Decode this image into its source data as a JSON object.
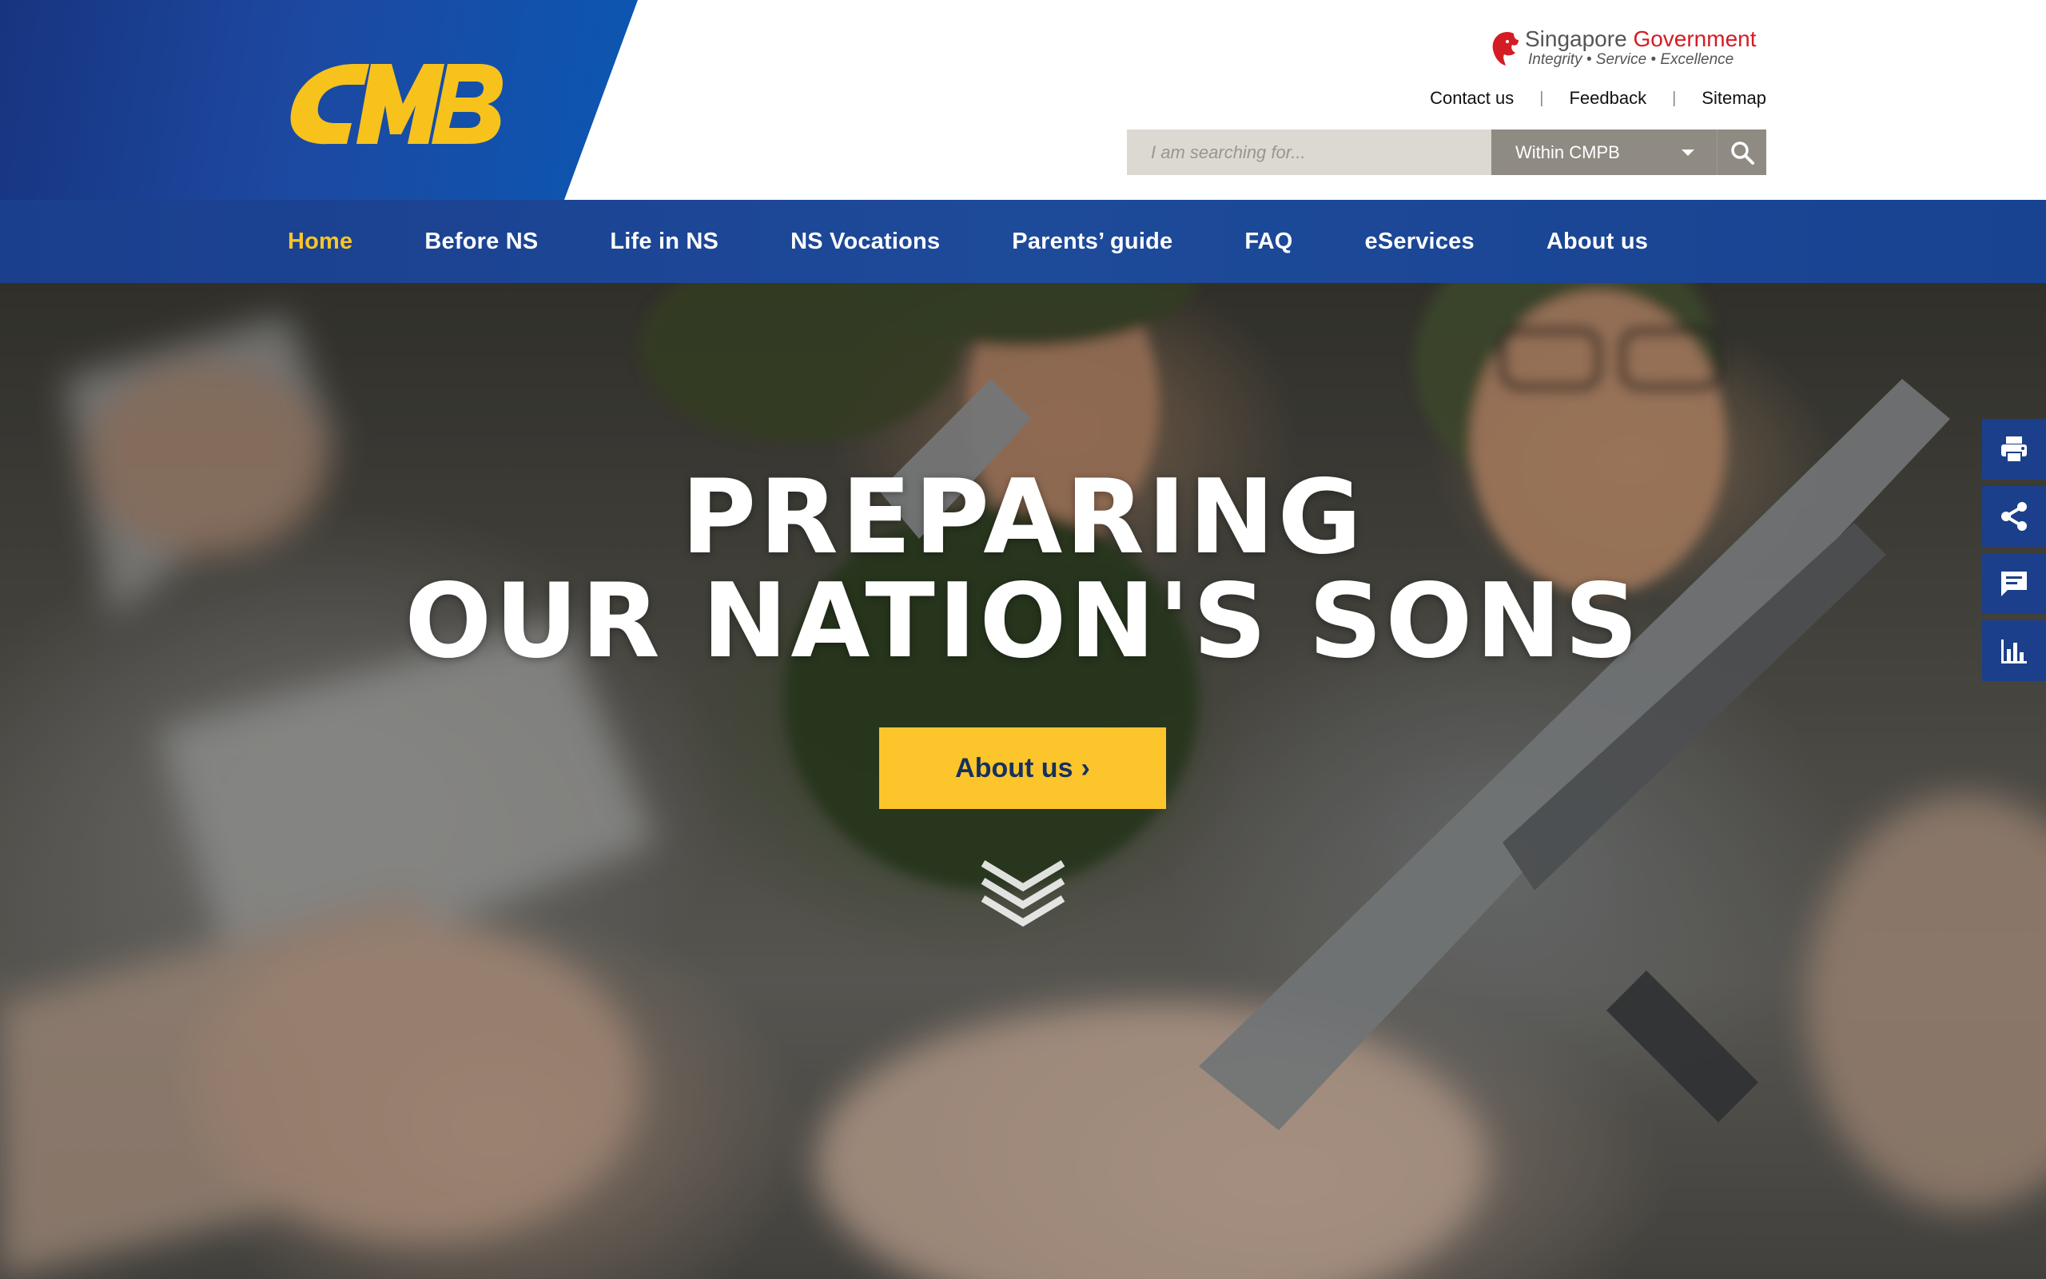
{
  "header": {
    "logo_text": "CMPB",
    "gov": {
      "title_part1": "Singapore ",
      "title_part2": "Government",
      "tagline": "Integrity  •  Service  •  Excellence"
    },
    "util_links": [
      {
        "label": "Contact us"
      },
      {
        "label": "Feedback"
      },
      {
        "label": "Sitemap"
      }
    ],
    "util_separator": "|",
    "search": {
      "placeholder": "I am searching for...",
      "scope_selected": "Within CMPB",
      "icon": "search-icon"
    }
  },
  "nav": {
    "items": [
      {
        "label": "Home",
        "active": true
      },
      {
        "label": "Before NS"
      },
      {
        "label": "Life in NS"
      },
      {
        "label": "NS Vocations"
      },
      {
        "label": "Parents’ guide"
      },
      {
        "label": "FAQ"
      },
      {
        "label": "eServices"
      },
      {
        "label": "About us"
      }
    ]
  },
  "hero": {
    "title_line1": "PREPARING",
    "title_line2": "OUR NATION'S SONS",
    "cta_label": "About us",
    "cta_arrow": "›",
    "scroll_icon": "chevrons-down-icon"
  },
  "side_tools": [
    {
      "icon": "print-icon"
    },
    {
      "icon": "share-icon"
    },
    {
      "icon": "feedback-chat-icon"
    },
    {
      "icon": "bar-chart-icon"
    }
  ],
  "colors": {
    "brand_blue": "#1b3f8a",
    "accent_yellow": "#fcc52b",
    "gov_red": "#d41c24"
  }
}
